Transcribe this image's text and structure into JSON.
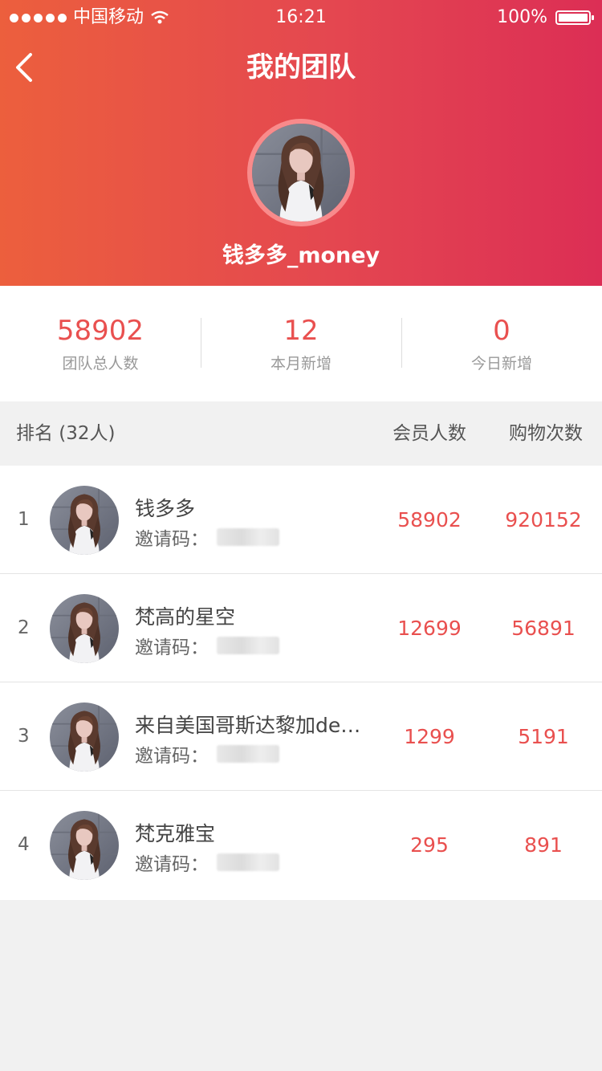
{
  "status_bar": {
    "carrier": "中国移动",
    "time": "16:21",
    "battery": "100%"
  },
  "nav": {
    "title": "我的团队"
  },
  "profile": {
    "username": "钱多多_money"
  },
  "stats": [
    {
      "value": "58902",
      "label": "团队总人数"
    },
    {
      "value": "12",
      "label": "本月新增"
    },
    {
      "value": "0",
      "label": "今日新增"
    }
  ],
  "table": {
    "rank_header": "排名 (32人)",
    "col1_header": "会员人数",
    "col2_header": "购物次数",
    "rows": [
      {
        "rank": "1",
        "name": "钱多多",
        "code_label": "邀请码：",
        "members": "58902",
        "purchases": "920152"
      },
      {
        "rank": "2",
        "name": "梵高的星空",
        "code_label": "邀请码：",
        "members": "12699",
        "purchases": "56891"
      },
      {
        "rank": "3",
        "name": "来自美国哥斯达黎加de…",
        "code_label": "邀请码：",
        "members": "1299",
        "purchases": "5191"
      },
      {
        "rank": "4",
        "name": "梵克雅宝",
        "code_label": "邀请码：",
        "members": "295",
        "purchases": "891"
      }
    ]
  },
  "colors": {
    "accent": "#e9504f",
    "header_gradient_start": "#ec5f3d",
    "header_gradient_end": "#dc2e55"
  }
}
